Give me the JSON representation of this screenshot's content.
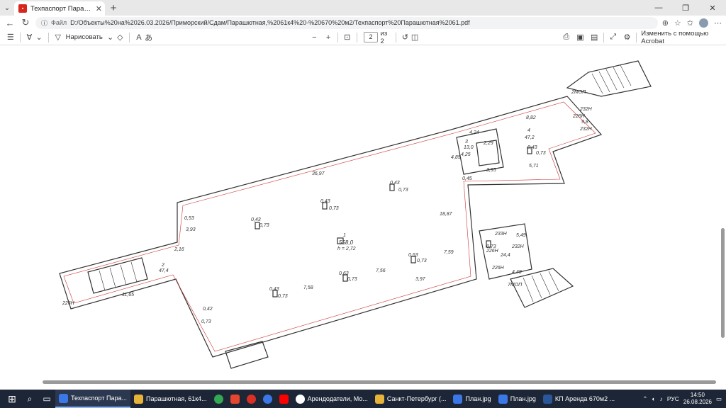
{
  "tab": {
    "title": "Техпаспорт Парашютная 61.pdf",
    "icon": "pdf-icon"
  },
  "address": {
    "prefix": "Файл",
    "url": "D:/Объекты%20на%2026.03.2026/Приморский/Сдам/Парашютная,%2061к4%20-%20670%20м2/Техпаспорт%20Парашютная%2061.pdf"
  },
  "pdf_toolbar": {
    "draw_label": "Нарисовать",
    "page_current": "2",
    "page_total": "из 2",
    "acrobat_label": "Изменить с помощью Acrobat"
  },
  "plan": {
    "labels": [
      "2МОП",
      "232Н",
      "226Н",
      "9,8",
      "232Н",
      "4,24",
      "4",
      "47,2",
      "3",
      "13,0",
      "2,29",
      "4,25",
      "4,85",
      "0,43",
      "0,73",
      "5,71",
      "3,95",
      "0,45",
      "36,97",
      "8,82",
      "0,43",
      "0,73",
      "0,43",
      "0,73",
      "18,87",
      "0,43",
      "0,73",
      "1",
      "558,0",
      "h = 2,72",
      "0,53",
      "3,93",
      "2,16",
      "2",
      "47,4",
      "0,63",
      "0,73",
      "7,59",
      "0,63",
      "0,73",
      "7,56",
      "3,97",
      "0,43",
      "0,73",
      "7,58",
      "0,42",
      "0,73",
      "11,65",
      "226Н",
      "233Н",
      "5,49",
      "226Н",
      "232Н",
      "24,4",
      "226Н",
      "4,48",
      "7МОП",
      "0,73"
    ]
  },
  "taskbar": {
    "items": [
      {
        "label": "Техпаспорт Пара...",
        "color": "#3b78e7",
        "active": true
      },
      {
        "label": "Парашютная, 61к4...",
        "color": "#e8b339",
        "active": false
      },
      {
        "label": "",
        "color": "#34a853",
        "active": false
      },
      {
        "label": "",
        "color": "#e5462f",
        "active": false
      },
      {
        "label": "",
        "color": "#d93025",
        "active": false
      },
      {
        "label": "",
        "color": "#3b78e7",
        "active": false
      },
      {
        "label": "",
        "color": "#ff0000",
        "active": false
      },
      {
        "label": "Арендодатели, Мо...",
        "color": "#ffffff",
        "active": false
      },
      {
        "label": "Санкт-Петербург (...",
        "color": "#e8b339",
        "active": false
      },
      {
        "label": "План.jpg",
        "color": "#3b78e7",
        "active": false
      },
      {
        "label": "План.jpg",
        "color": "#3b78e7",
        "active": false
      },
      {
        "label": "КП Аренда 670м2 ...",
        "color": "#2b579a",
        "active": false
      }
    ],
    "lang": "РУС",
    "time": "14:50",
    "date": "26.08.2026"
  }
}
